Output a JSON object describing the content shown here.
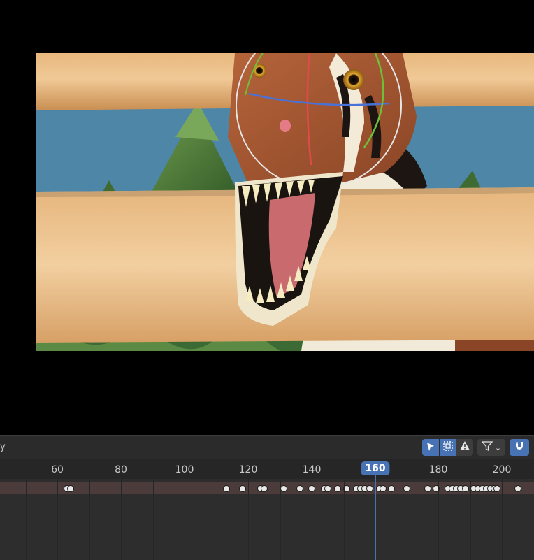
{
  "viewport": {
    "scene": "dinosaur-behind-fence-render"
  },
  "timeline": {
    "header_label": "y",
    "toolbar": {
      "select_icon": "cursor-arrow-icon",
      "box_select_icon": "box-select-icon",
      "warning_icon": "warning-icon",
      "filter_icon": "funnel-filter-icon",
      "filter_chevron": "⌄",
      "snap_icon": "magnet-snap-icon"
    },
    "ruler_ticks": [
      "60",
      "80",
      "100",
      "120",
      "140",
      "160",
      "180",
      "200"
    ],
    "current_frame": "160",
    "colors": {
      "accent": "#4772b3",
      "summary_row": "#4b3b3b",
      "keyframe": "#e8e8e8"
    }
  }
}
